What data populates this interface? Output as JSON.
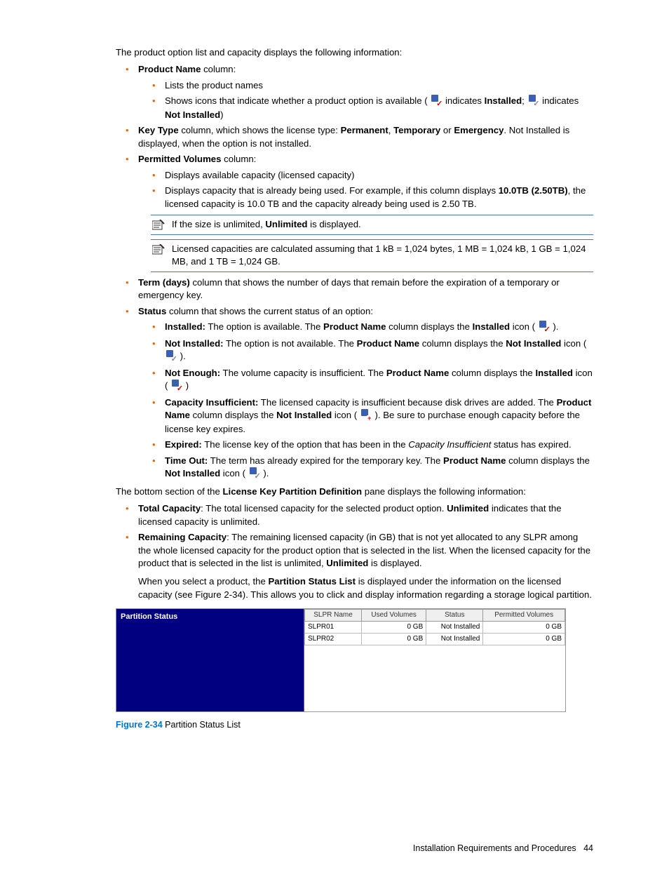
{
  "intro": "The product option list and capacity displays the following information:",
  "items": {
    "pn": {
      "label": "Product Name",
      "suffix": " column:",
      "sub1": "Lists the product names",
      "sub2_a": "Shows icons that indicate whether a product option is available (",
      "sub2_b": " indicates ",
      "sub2_installed": "Installed",
      "sub2_c": "; ",
      "sub2_d": " indicates ",
      "sub2_ni": "Not Installed",
      "sub2_e": ")"
    },
    "kt": {
      "a": "Key Type",
      "b": " column, which shows the license type: ",
      "perm": "Permanent",
      "c": ", ",
      "temp": "Temporary",
      "d": " or ",
      "emerg": "Emergency",
      "e": ". Not Installed is displayed, when the option is not installed."
    },
    "pv": {
      "a": "Permitted Volumes",
      "b": " column:",
      "sub1": "Displays available capacity (licensed capacity)",
      "sub2_a": "Displays capacity that is already being used. For example, if this column displays ",
      "sub2_b": "10.0TB (2.50TB)",
      "sub2_c": ", the licensed capacity is 10.0 TB and the capacity already being used is 2.50 TB."
    },
    "note1_a": "If the size is unlimited, ",
    "note1_b": "Unlimited",
    "note1_c": " is displayed.",
    "note2": "Licensed capacities are calculated assuming that 1 kB = 1,024 bytes, 1 MB = 1,024 kB, 1 GB = 1,024 MB, and 1 TB = 1,024 GB.",
    "term": {
      "a": "Term (days)",
      "b": " column that shows the number of days that remain before the expiration of a temporary or emergency key."
    },
    "status": {
      "a": "Status",
      "b": " column that shows the current status of an option:",
      "inst": {
        "a": "Installed:",
        "b": " The option is available. The ",
        "c": "Product Name",
        "d": " column displays the ",
        "e": "Installed",
        "f": " icon (",
        "g": ")."
      },
      "ninst": {
        "a": "Not Installed:",
        "b": "  The option is not available. The ",
        "c": "Product Name",
        "d": " column displays the ",
        "e": "Not Installed",
        "f": " icon (",
        "g": ")."
      },
      "ne": {
        "a": "Not Enough:",
        "b": " The volume capacity is insufficient. The ",
        "c": "Product Name",
        "d": " column displays the ",
        "e": "Installed",
        "f": " icon (",
        "g": ")"
      },
      "ci": {
        "a": "Capacity Insufficient:",
        "b": " The licensed capacity is insufficient because disk drives are added. The ",
        "c": "Product Name",
        "d": " column displays the ",
        "e": "Not Installed",
        "f": " icon (",
        "g": "). Be sure to purchase enough capacity before the license key expires."
      },
      "exp": {
        "a": "Expired:",
        "b": " The license key of the option that has been in the ",
        "c": "Capacity Insufficient",
        "d": " status has expired."
      },
      "to": {
        "a": "Time Out:",
        "b": " The term has already expired for the temporary key. The ",
        "c": "Product Name",
        "d": " column displays the ",
        "e": "Not Installed",
        "f": " icon (",
        "g": ")."
      }
    }
  },
  "bottom_intro_a": "The bottom section of the ",
  "bottom_intro_b": "License Key Partition Definition",
  "bottom_intro_c": " pane displays the following information:",
  "tc": {
    "a": "Total Capacity",
    "b": ": The total licensed capacity for the selected product option. ",
    "c": "Unlimited",
    "d": " indicates that the licensed capacity is unlimited."
  },
  "rc": {
    "a": "Remaining Capacity",
    "b": ": The remaining licensed capacity (in GB) that is not yet allocated to any SLPR among the whole licensed capacity for the product option that is selected in the list. When the licensed capacity for the product that is selected in the list is unlimited, ",
    "c": "Unlimited",
    "d": " is displayed."
  },
  "select_a": "When you select a product, the ",
  "select_b": "Partition Status List",
  "select_c": " is displayed under the information on the licensed capacity (see Figure 2-34). This allows you to click and display information regarding a storage logical partition.",
  "figure_title": "Partition Status",
  "chart_data": {
    "type": "table",
    "title": "Partition Status",
    "columns": [
      "SLPR Name",
      "Used Volumes",
      "Status",
      "Permitted Volumes"
    ],
    "rows": [
      {
        "slpr": "SLPR01",
        "used": "0 GB",
        "status": "Not Installed",
        "permitted": "0 GB"
      },
      {
        "slpr": "SLPR02",
        "used": "0 GB",
        "status": "Not Installed",
        "permitted": "0 GB"
      }
    ]
  },
  "figcap": {
    "a": "Figure 2-34",
    "b": " Partition Status List"
  },
  "footer": {
    "a": "Installation Requirements and Procedures",
    "b": "44"
  }
}
